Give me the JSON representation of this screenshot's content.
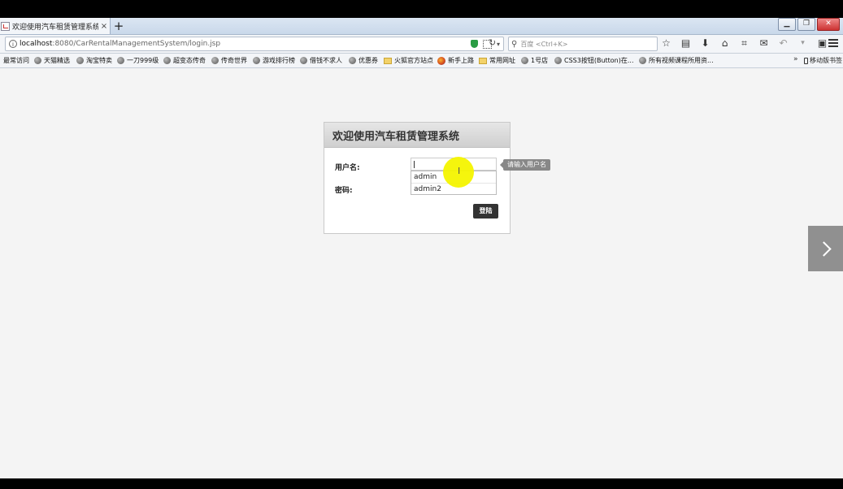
{
  "browser": {
    "tab": {
      "title": "欢迎使用汽车租赁管理系统",
      "close": "×"
    },
    "new_tab": "+",
    "url": {
      "host": "localhost",
      "path": ":8080/CarRentalManagementSystem/login.jsp"
    },
    "search_placeholder": "百度 <Ctrl+K>",
    "bookmarks": [
      {
        "label": "最常访问",
        "icon": "none"
      },
      {
        "label": "天猫精选",
        "icon": "globe"
      },
      {
        "label": "淘宝特卖",
        "icon": "globe"
      },
      {
        "label": "一刀999级",
        "icon": "globe"
      },
      {
        "label": "超变态传奇",
        "icon": "globe"
      },
      {
        "label": "传奇世界",
        "icon": "globe"
      },
      {
        "label": "游戏排行榜",
        "icon": "globe"
      },
      {
        "label": "借钱不求人",
        "icon": "globe"
      },
      {
        "label": "优惠券",
        "icon": "globe"
      },
      {
        "label": "火狐官方站点",
        "icon": "folder"
      },
      {
        "label": "新手上路",
        "icon": "firefox"
      },
      {
        "label": "常用网址",
        "icon": "folder"
      },
      {
        "label": "1号店",
        "icon": "globe"
      },
      {
        "label": "CSS3按钮(Button)在...",
        "icon": "globe"
      },
      {
        "label": "所有视频课程所用资...",
        "icon": "globe"
      }
    ],
    "bookmarks_more": "»",
    "mobile_bookmarks": "移动版书签"
  },
  "login": {
    "title": "欢迎使用汽车租赁管理系统",
    "username_label": "用户名:",
    "password_label": "密码:",
    "username_value": "",
    "autocomplete": [
      "admin",
      "admin2"
    ],
    "tooltip": "请输入用户名",
    "submit_label": "登陆"
  },
  "colors": {
    "highlight": "#f4f400",
    "button": "#333333",
    "page_bg": "#f4f4f4"
  }
}
